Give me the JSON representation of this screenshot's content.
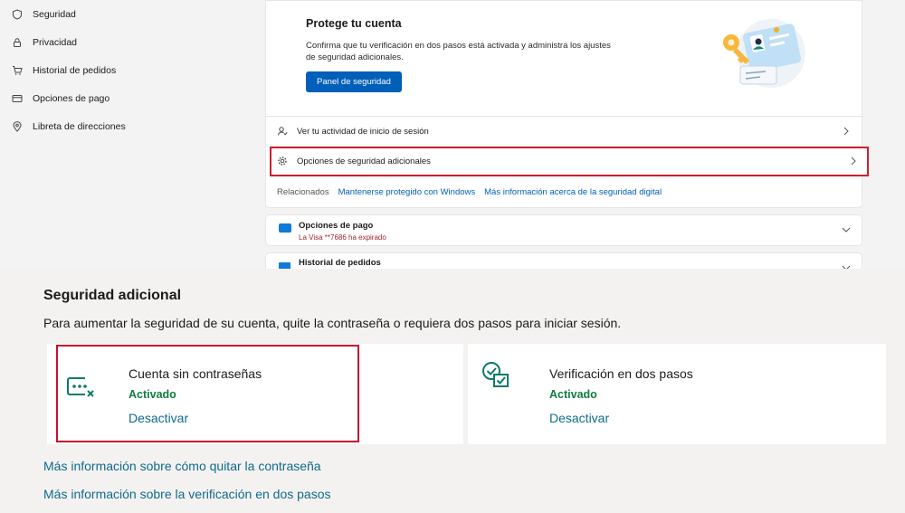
{
  "sidebar": {
    "items": [
      {
        "label": "Seguridad",
        "icon": "shield-icon"
      },
      {
        "label": "Privacidad",
        "icon": "lock-icon"
      },
      {
        "label": "Historial de pedidos",
        "icon": "cart-icon"
      },
      {
        "label": "Opciones de pago",
        "icon": "credit-card-icon"
      },
      {
        "label": "Libreta de direcciones",
        "icon": "location-pin-icon"
      }
    ]
  },
  "protect": {
    "title": "Protege tu cuenta",
    "description": "Confirma que tu verificación en dos pasos está activada y administra los ajustes de seguridad adicionales.",
    "button": "Panel de seguridad"
  },
  "rows": [
    {
      "label": "Ver tu actividad de inicio de sesión",
      "icon": "sign-in-activity-icon"
    },
    {
      "label": "Opciones de seguridad adicionales",
      "icon": "gear-icon"
    }
  ],
  "related": {
    "label": "Relacionados",
    "links": [
      "Mantenerse protegido con Windows",
      "Más información acerca de la seguridad digital"
    ]
  },
  "payment": {
    "title": "Opciones de pago",
    "subtitle": "La Visa **7686 ha expirado"
  },
  "history": {
    "title": "Historial de pedidos"
  },
  "extra": {
    "title": "Seguridad adicional",
    "intro": "Para aumentar la seguridad de su cuenta, quite la contraseña o requiera dos pasos para iniciar sesión.",
    "options": [
      {
        "name": "Cuenta sin contraseñas",
        "status": "Activado",
        "action": "Desactivar",
        "icon": "passwordless-icon"
      },
      {
        "name": "Verificación en dos pasos",
        "status": "Activado",
        "action": "Desactivar",
        "icon": "two-step-verification-icon"
      }
    ],
    "links": [
      "Más información sobre cómo quitar la contraseña",
      "Más información sobre la verificación en dos pasos"
    ]
  },
  "colors": {
    "accent": "#005fb8",
    "status_green": "#107c41",
    "link_teal": "#0e6b8a",
    "highlight_red": "#d0202e"
  }
}
